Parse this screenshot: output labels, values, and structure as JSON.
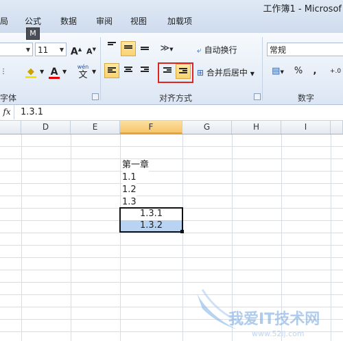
{
  "window": {
    "title": "工作簿1 - Microsof"
  },
  "tabs": [
    {
      "label": "局"
    },
    {
      "label": "公式"
    },
    {
      "label": "数据"
    },
    {
      "label": "审阅"
    },
    {
      "label": "视图"
    },
    {
      "label": "加载项"
    }
  ],
  "keytip": "M",
  "font": {
    "size_value": "11",
    "grow_label": "A",
    "shrink_label": "A",
    "phonetic_label": "wén",
    "phonetic_char": "文",
    "font_color_label": "A",
    "group_label": "字体"
  },
  "alignment": {
    "wrap_text_label": "自动换行",
    "merge_center_label": "合并后居中",
    "group_label": "对齐方式"
  },
  "number": {
    "format_value": "常规",
    "percent_label": "%",
    "comma_label": ",",
    "decimal_label": "+.0",
    "group_label": "数字"
  },
  "formula_bar": {
    "fx_label": "fx",
    "value": "1.3.1"
  },
  "columns": [
    {
      "label": "D"
    },
    {
      "label": "E"
    },
    {
      "label": "F"
    },
    {
      "label": "G"
    },
    {
      "label": "H"
    },
    {
      "label": "I"
    }
  ],
  "cells": [
    {
      "text": "第一章"
    },
    {
      "text": "1.1"
    },
    {
      "text": "1.2"
    },
    {
      "text": "1.3"
    },
    {
      "text": "1.3.1"
    },
    {
      "text": "1.3.2"
    }
  ],
  "watermark": {
    "text": "我爱IT技术网",
    "url": "www.52ij.com"
  },
  "colors": {
    "selection_border": "#111111",
    "selection_fill": "#b9d3f2",
    "active_button": "#f9d36e",
    "highlight_box": "#e0241c"
  }
}
